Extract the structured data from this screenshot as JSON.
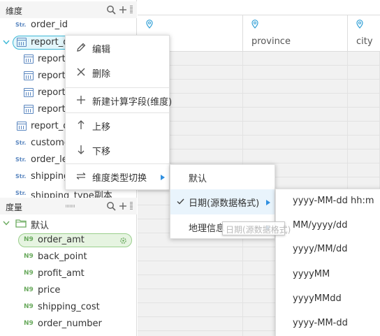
{
  "dimension_panel": {
    "title": "维度",
    "items": [
      {
        "type_tag": "Str.",
        "label": "order_id"
      },
      {
        "label": "report_d"
      },
      {
        "label": "report_"
      },
      {
        "label": "report_"
      },
      {
        "label": "report_"
      },
      {
        "label": "report_"
      },
      {
        "label": "report_d"
      },
      {
        "type_tag": "Str.",
        "label": "custome"
      },
      {
        "type_tag": "Str.",
        "label": "order_le"
      },
      {
        "type_tag": "Str.",
        "label": "shipping"
      },
      {
        "type_tag": "Str.",
        "label": "shipping_type副本"
      }
    ]
  },
  "measure_panel": {
    "title": "度量",
    "group": "默认",
    "items": [
      {
        "type_tag": "N9",
        "label": "order_amt"
      },
      {
        "type_tag": "N9",
        "label": "back_point"
      },
      {
        "type_tag": "N9",
        "label": "profit_amt"
      },
      {
        "type_tag": "N9",
        "label": "price"
      },
      {
        "type_tag": "N9",
        "label": "shipping_cost"
      },
      {
        "type_tag": "N9",
        "label": "order_number"
      }
    ]
  },
  "table": {
    "columns": [
      "",
      "province",
      "city"
    ]
  },
  "context_menu": {
    "items": [
      "编辑",
      "删除",
      "新建计算字段(维度)",
      "上移",
      "下移",
      "维度类型切换"
    ]
  },
  "type_submenu": {
    "items": [
      "默认",
      "日期(源数据格式)",
      "地理信息"
    ]
  },
  "date_submenu": {
    "items": [
      "yyyy-MM-dd hh:m",
      "MM/yyyy/dd",
      "yyyy/MM/dd",
      "yyyyMM",
      "yyyyMMdd",
      "yyyy-MM-dd"
    ]
  },
  "drag_ghost": {
    "label": "日期(源数据格式)"
  },
  "colors": {
    "accent_blue": "#2f8fe0",
    "selected_border": "#3bb7d6",
    "measure_green": "#6aaa5e"
  }
}
